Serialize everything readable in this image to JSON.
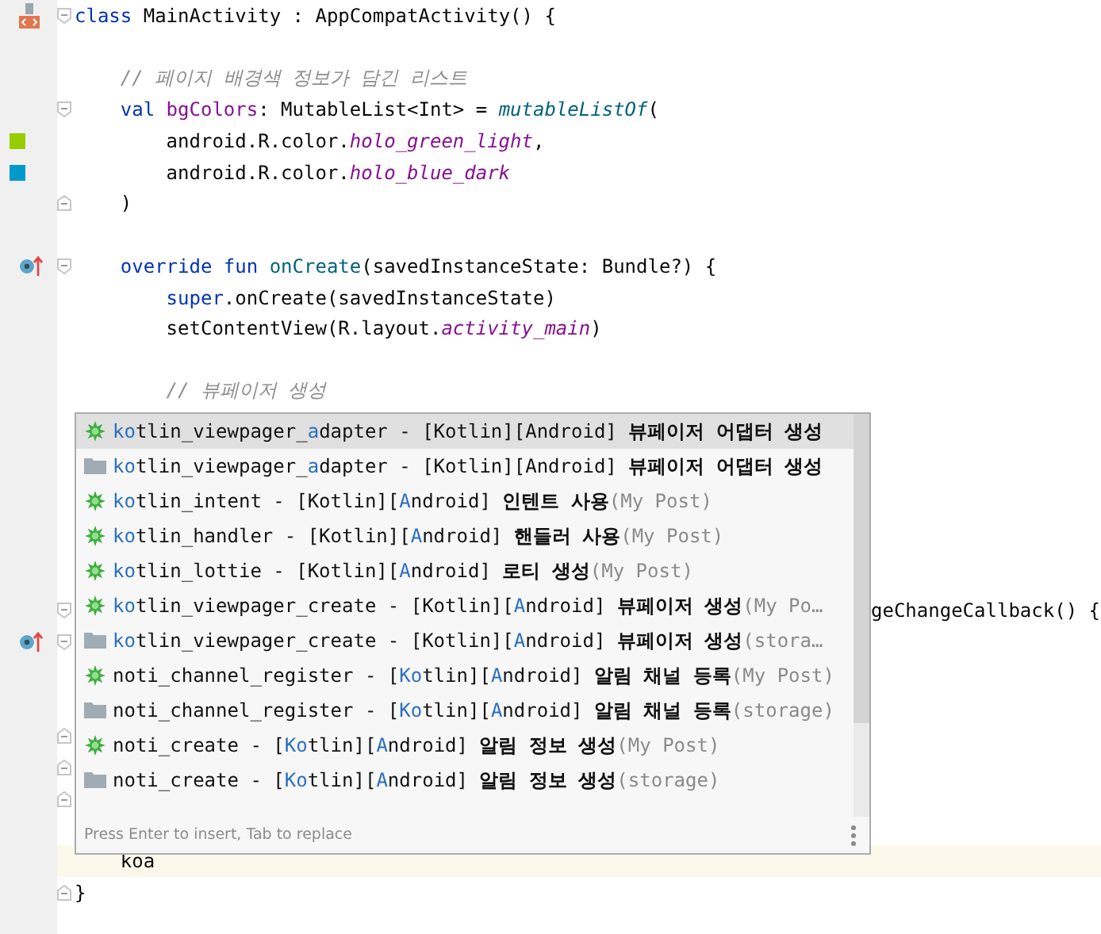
{
  "editor": {
    "lines": [
      {
        "kind": "class-file",
        "fold_start": true,
        "tokens": [
          {
            "text": "class",
            "kind": "keyword"
          },
          {
            "text": " MainActivity : AppCompatActivity() {",
            "kind": "plain"
          }
        ]
      },
      {
        "kind": "blank"
      },
      {
        "tokens": [
          {
            "text": "    // 페이지 배경색 정보가 담긴 리스트",
            "kind": "comment"
          }
        ]
      },
      {
        "fold_start": true,
        "tokens": [
          {
            "text": "    val",
            "kind": "keyword"
          },
          {
            "text": " bgColors",
            "kind": "property"
          },
          {
            "text": ": MutableList<Int> = ",
            "kind": "plain"
          },
          {
            "text": "mutableListOf",
            "kind": "call"
          },
          {
            "text": "(",
            "kind": "plain"
          }
        ]
      },
      {
        "kind": "color",
        "color": "#99cc00",
        "tokens": [
          {
            "text": "        android.R.color.",
            "kind": "plain"
          },
          {
            "text": "holo_green_light",
            "kind": "static"
          },
          {
            "text": ",",
            "kind": "plain"
          }
        ]
      },
      {
        "kind": "color",
        "color": "#0099cc",
        "tokens": [
          {
            "text": "        android.R.color.",
            "kind": "plain"
          },
          {
            "text": "holo_blue_dark",
            "kind": "static"
          }
        ]
      },
      {
        "fold_end": true,
        "tokens": [
          {
            "text": "    )",
            "kind": "plain"
          }
        ]
      },
      {
        "kind": "blank"
      },
      {
        "kind": "override",
        "fold_start": true,
        "tokens": [
          {
            "text": "    override fun",
            "kind": "keyword"
          },
          {
            "text": " onCreate",
            "kind": "decl"
          },
          {
            "text": "(savedInstanceState: Bundle?) {",
            "kind": "plain"
          }
        ]
      },
      {
        "tokens": [
          {
            "text": "        super",
            "kind": "keyword"
          },
          {
            "text": ".onCreate(savedInstanceState)",
            "kind": "plain"
          }
        ]
      },
      {
        "tokens": [
          {
            "text": "        setContentView(R.layout.",
            "kind": "plain"
          },
          {
            "text": "activity_main",
            "kind": "static"
          },
          {
            "text": ")",
            "kind": "plain"
          }
        ]
      },
      {
        "kind": "blank"
      },
      {
        "tokens": [
          {
            "text": "        // 뷰페이저 생성",
            "kind": "comment"
          }
        ]
      },
      {
        "kind": "blank"
      },
      {
        "kind": "blank"
      },
      {
        "kind": "blank"
      },
      {
        "kind": "blank"
      },
      {
        "kind": "blank"
      },
      {
        "kind": "blank"
      },
      {
        "fold_start": true,
        "partial": true,
        "tokens": [
          {
            "text": "geChangeCallback() {",
            "kind": "plain"
          }
        ]
      },
      {
        "kind": "override",
        "fold_start": true
      },
      {
        "kind": "blank"
      },
      {
        "kind": "blank"
      },
      {
        "fold_end": true
      },
      {
        "fold_end": true
      },
      {
        "fold_end": true
      },
      {
        "kind": "blank"
      },
      {
        "current": true,
        "tokens": [
          {
            "text": "    koa",
            "kind": "plain"
          }
        ]
      },
      {
        "fold_end": true,
        "tokens": [
          {
            "text": "}",
            "kind": "plain"
          }
        ]
      }
    ]
  },
  "completion": {
    "items": [
      {
        "kind": "template",
        "selected": true,
        "parts": [
          {
            "text": "ko",
            "match": true
          },
          {
            "text": "tlin_viewpager_",
            "match": false
          },
          {
            "text": "a",
            "match": true
          },
          {
            "text": "dapter - [Kotlin][Android] ",
            "match": false
          }
        ],
        "desc": "뷰페이저 어댑터 생성"
      },
      {
        "kind": "folder",
        "selected": false,
        "parts": [
          {
            "text": "ko",
            "match": true
          },
          {
            "text": "tlin_viewpager_",
            "match": false
          },
          {
            "text": "a",
            "match": true
          },
          {
            "text": "dapter - [Kotlin][Android] ",
            "match": false
          }
        ],
        "desc": "뷰페이저 어댑터 생성"
      },
      {
        "kind": "template",
        "selected": false,
        "parts": [
          {
            "text": "ko",
            "match": true
          },
          {
            "text": "tlin_intent - [Kotlin][",
            "match": false
          },
          {
            "text": "A",
            "match": true
          },
          {
            "text": "ndroid] ",
            "match": false
          }
        ],
        "desc": "인텐트 사용",
        "hint": "(My Post)"
      },
      {
        "kind": "template",
        "selected": false,
        "parts": [
          {
            "text": "ko",
            "match": true
          },
          {
            "text": "tlin_handler - [Kotlin][",
            "match": false
          },
          {
            "text": "A",
            "match": true
          },
          {
            "text": "ndroid] ",
            "match": false
          }
        ],
        "desc": "핸들러 사용",
        "hint": "(My Post)"
      },
      {
        "kind": "template",
        "selected": false,
        "parts": [
          {
            "text": "ko",
            "match": true
          },
          {
            "text": "tlin_lottie - [Kotlin][",
            "match": false
          },
          {
            "text": "A",
            "match": true
          },
          {
            "text": "ndroid] ",
            "match": false
          }
        ],
        "desc": "로티 생성",
        "hint": "(My Post)"
      },
      {
        "kind": "template",
        "selected": false,
        "parts": [
          {
            "text": "ko",
            "match": true
          },
          {
            "text": "tlin_viewpager_create - [Kotlin][",
            "match": false
          },
          {
            "text": "A",
            "match": true
          },
          {
            "text": "ndroid] ",
            "match": false
          }
        ],
        "desc": "뷰페이저 생성",
        "hint": "(My Po…"
      },
      {
        "kind": "folder",
        "selected": false,
        "parts": [
          {
            "text": "ko",
            "match": true
          },
          {
            "text": "tlin_viewpager_create - [Kotlin][",
            "match": false
          },
          {
            "text": "A",
            "match": true
          },
          {
            "text": "ndroid] ",
            "match": false
          }
        ],
        "desc": "뷰페이저 생성",
        "hint": "(stora…"
      },
      {
        "kind": "template",
        "selected": false,
        "parts": [
          {
            "text": "noti_channel_register - [",
            "match": false
          },
          {
            "text": "Ko",
            "match": true
          },
          {
            "text": "tlin][",
            "match": false
          },
          {
            "text": "A",
            "match": true
          },
          {
            "text": "ndroid] ",
            "match": false
          }
        ],
        "desc": "알림 채널 등록",
        "hint": "(My Post)"
      },
      {
        "kind": "folder",
        "selected": false,
        "parts": [
          {
            "text": "noti_channel_register - [",
            "match": false
          },
          {
            "text": "Ko",
            "match": true
          },
          {
            "text": "tlin][",
            "match": false
          },
          {
            "text": "A",
            "match": true
          },
          {
            "text": "ndroid] ",
            "match": false
          }
        ],
        "desc": "알림 채널 등록",
        "hint": "(storage)"
      },
      {
        "kind": "template",
        "selected": false,
        "parts": [
          {
            "text": "noti_create - [",
            "match": false
          },
          {
            "text": "Ko",
            "match": true
          },
          {
            "text": "tlin][",
            "match": false
          },
          {
            "text": "A",
            "match": true
          },
          {
            "text": "ndroid] ",
            "match": false
          }
        ],
        "desc": "알림 정보 생성",
        "hint": "(My Post)"
      },
      {
        "kind": "folder",
        "selected": false,
        "parts": [
          {
            "text": "noti_create - [",
            "match": false
          },
          {
            "text": "Ko",
            "match": true
          },
          {
            "text": "tlin][",
            "match": false
          },
          {
            "text": "A",
            "match": true
          },
          {
            "text": "ndroid] ",
            "match": false
          }
        ],
        "desc": "알림 정보 생성",
        "hint": "(storage)"
      }
    ],
    "footer": "Press Enter to insert, Tab to replace"
  }
}
